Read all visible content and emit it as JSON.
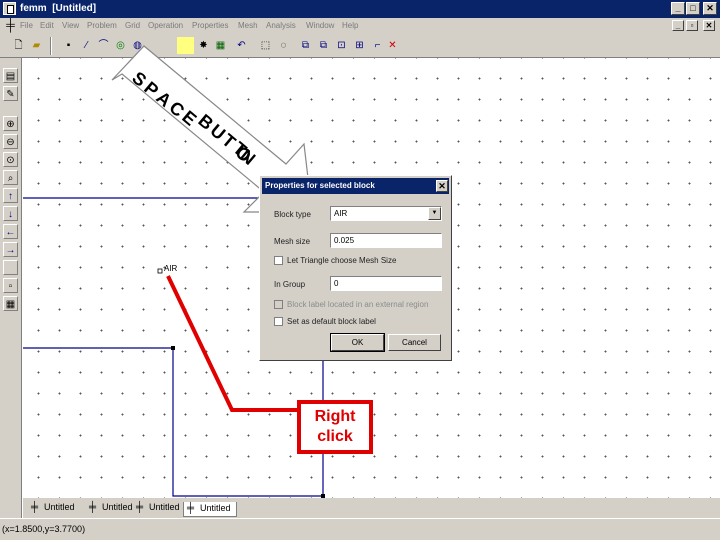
{
  "window": {
    "title": "femm  [Untitled]"
  },
  "menu": {
    "items": [
      "File",
      "Edit",
      "View",
      "Problem",
      "Grid",
      "Operation",
      "Properties",
      "Mesh",
      "Analysis",
      "Window",
      "Help"
    ]
  },
  "canvas": {
    "block_label_text": "AIR"
  },
  "tabs": [
    {
      "label": "Untitled"
    },
    {
      "label": "Untitled"
    },
    {
      "label": "Untitled"
    },
    {
      "label": "Untitled"
    }
  ],
  "statusbar": {
    "coords": "(x=1.8500,y=3.7700)"
  },
  "dialog": {
    "title": "Properties for selected block",
    "block_type_label": "Block type",
    "block_type_value": "AIR",
    "mesh_size_label": "Mesh size",
    "mesh_size_value": "0.025",
    "auto_mesh_label": "Let Triangle choose Mesh Size",
    "in_group_label": "In Group",
    "in_group_value": "0",
    "block_in_magnet_label": "Block label located in an external region",
    "default_label_label": "Set as default block label",
    "ok_label": "OK",
    "cancel_label": "Cancel"
  },
  "annotations": {
    "arrow_text": "SPACE BUTTON",
    "arrow_letters": [
      "S",
      "P",
      "A",
      "C",
      "E",
      "B",
      "U",
      "T",
      "T",
      "O",
      "N"
    ],
    "callout_line1": "Right",
    "callout_line2": "click",
    "colors": {
      "callout": "#e00000",
      "arrow_fill": "#ffffff"
    }
  }
}
